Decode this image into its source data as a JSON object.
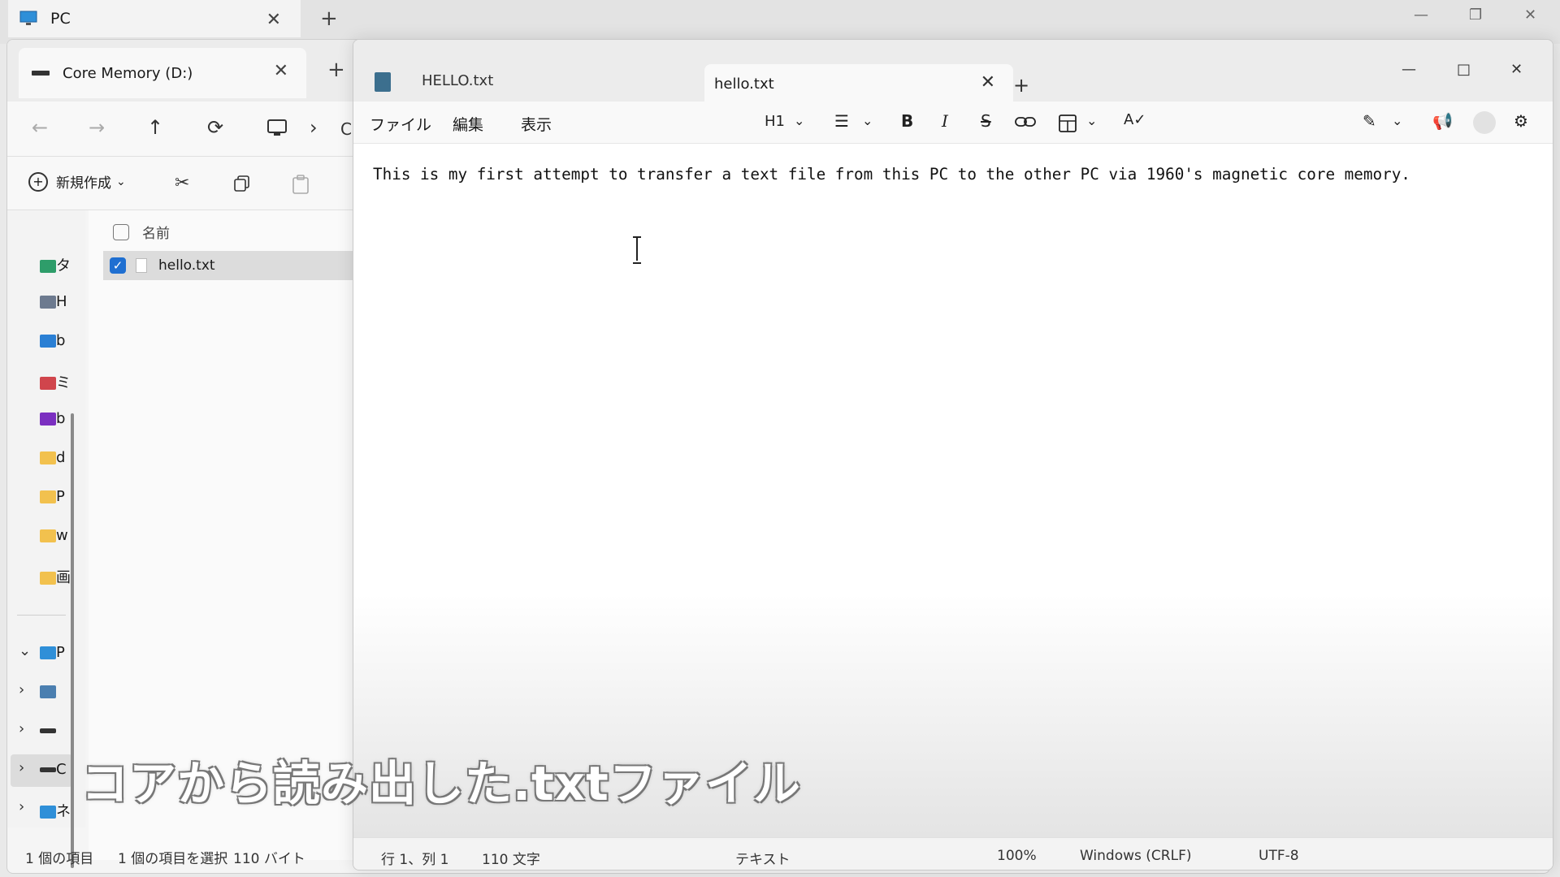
{
  "outer_window": {
    "tab_label": "PC",
    "new_tab": "+",
    "close": "✕",
    "minimize": "—",
    "restore": "❐"
  },
  "explorer": {
    "tab_label": "Core Memory (D:)",
    "tab_close": "✕",
    "new_tab": "+",
    "nav": {
      "back": "←",
      "forward": "→",
      "up": "↑",
      "refresh": "⟳",
      "chevron": "›",
      "path_partial": "C"
    },
    "command_bar": {
      "new_label": "新規作成",
      "new_chevron": "⌄"
    },
    "sidebar": {
      "items": [
        "タ",
        "H",
        "b",
        "ミ",
        "b",
        "d",
        "P",
        "w",
        "画"
      ],
      "tree": [
        "P",
        "",
        "",
        "C",
        "ネ"
      ]
    },
    "files": {
      "column_name": "名前",
      "rows": [
        {
          "name": "hello.txt",
          "checked": true
        }
      ]
    },
    "status": {
      "count": "1 個の項目",
      "selected": "1 個の項目を選択",
      "size": "110 バイト"
    }
  },
  "notepad": {
    "tabs": [
      {
        "label": "HELLO.txt",
        "active": false
      },
      {
        "label": "hello.txt",
        "active": true
      }
    ],
    "tab_close": "✕",
    "new_tab": "+",
    "window_controls": {
      "minimize": "—",
      "maximize": "□",
      "close": "✕"
    },
    "menus": [
      "ファイル",
      "編集",
      "表示"
    ],
    "toolbar": {
      "heading": "H1",
      "bold": "B",
      "italic": "I",
      "strike": "S"
    },
    "content": "This is my first attempt to transfer a text file from this PC to the other PC via 1960's magnetic core memory.",
    "status": {
      "position": "行 1、列 1",
      "chars": "110 文字",
      "format": "テキスト",
      "zoom": "100%",
      "line_ending": "Windows (CRLF)",
      "encoding": "UTF-8"
    }
  },
  "subtitle": "コアから読み出した.txtファイル",
  "colors": {
    "accent": "#1f6fd1",
    "selection": "#dcdcdc"
  }
}
